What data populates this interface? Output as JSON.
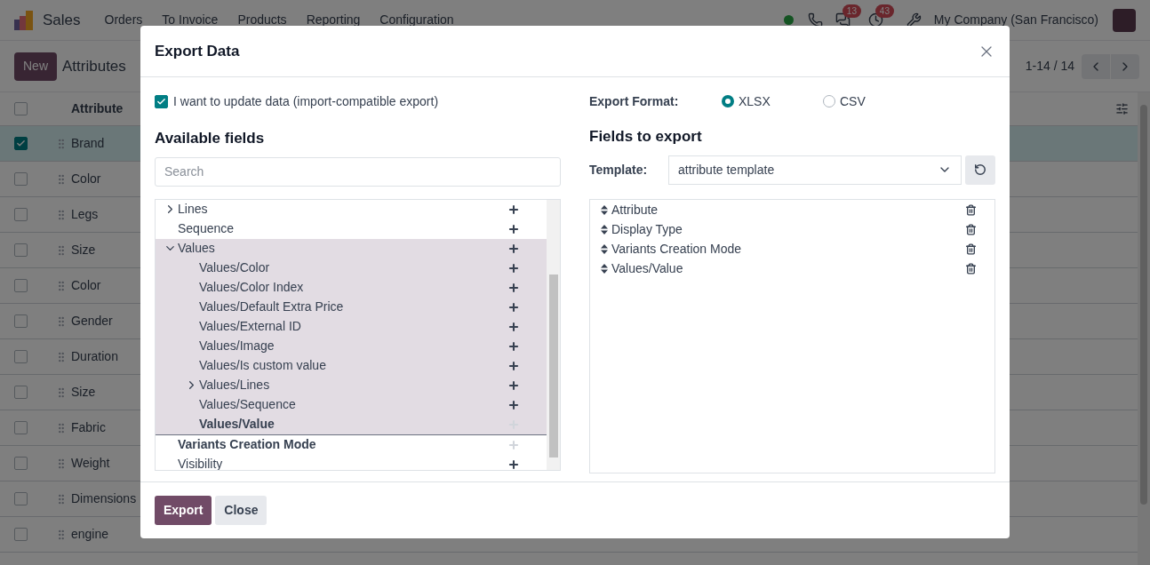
{
  "navbar": {
    "app": "Sales",
    "menu": [
      "Orders",
      "To Invoice",
      "Products",
      "Reporting",
      "Configuration"
    ],
    "messages_badge": "13",
    "activities_badge": "43",
    "company": "My Company (San Francisco)"
  },
  "control_panel": {
    "new_button": "New",
    "title": "Attributes",
    "pager": "1-14 / 14"
  },
  "list": {
    "column": "Attribute",
    "all_checked": false,
    "rows": [
      {
        "name": "Brand",
        "selected": true
      },
      {
        "name": "Color",
        "selected": false
      },
      {
        "name": "Legs",
        "selected": false
      },
      {
        "name": "Size",
        "selected": false
      },
      {
        "name": "Color",
        "selected": false
      },
      {
        "name": "Gender",
        "selected": false
      },
      {
        "name": "Duration",
        "selected": false
      },
      {
        "name": "Size",
        "selected": false
      },
      {
        "name": "Fabric",
        "selected": false
      },
      {
        "name": "Weight",
        "selected": false
      },
      {
        "name": "Dimensions",
        "selected": false
      },
      {
        "name": "engine",
        "selected": false
      }
    ]
  },
  "dialog": {
    "title": "Export Data",
    "import_compatible": {
      "label": "I want to update data (import-compatible export)",
      "checked": true
    },
    "available_fields": {
      "heading": "Available fields",
      "search_placeholder": "Search",
      "fields": [
        {
          "label": "Lines",
          "expanded": false,
          "selected": false,
          "added": false
        },
        {
          "label": "Sequence",
          "selected": false,
          "added": false
        },
        {
          "label": "Values",
          "expanded": true,
          "selected": true,
          "added": false,
          "children": [
            {
              "label": "Values/Color",
              "selected": false,
              "added": false
            },
            {
              "label": "Values/Color Index",
              "selected": false,
              "added": false
            },
            {
              "label": "Values/Default Extra Price",
              "selected": false,
              "added": false
            },
            {
              "label": "Values/External ID",
              "selected": false,
              "added": false
            },
            {
              "label": "Values/Image",
              "selected": false,
              "added": false
            },
            {
              "label": "Values/Is custom value",
              "selected": false,
              "added": false
            },
            {
              "label": "Values/Lines",
              "expanded": false,
              "selected": false,
              "added": false
            },
            {
              "label": "Values/Sequence",
              "selected": false,
              "added": false
            },
            {
              "label": "Values/Value",
              "selected": false,
              "added": true
            }
          ]
        },
        {
          "label": "Variants Creation Mode",
          "selected": false,
          "added": true
        },
        {
          "label": "Visibility",
          "selected": false,
          "added": false
        }
      ]
    },
    "export_format": {
      "label": "Export Format:",
      "options": [
        {
          "label": "XLSX",
          "selected": true
        },
        {
          "label": "CSV",
          "selected": false
        }
      ]
    },
    "fields_to_export": {
      "heading": "Fields to export",
      "template_label": "Template:",
      "template_value": "attribute template",
      "fields": [
        "Attribute",
        "Display Type",
        "Variants Creation Mode",
        "Values/Value"
      ]
    },
    "buttons": [
      {
        "label": "Export",
        "kind": "primary"
      },
      {
        "label": "Close",
        "kind": "secondary"
      }
    ]
  }
}
